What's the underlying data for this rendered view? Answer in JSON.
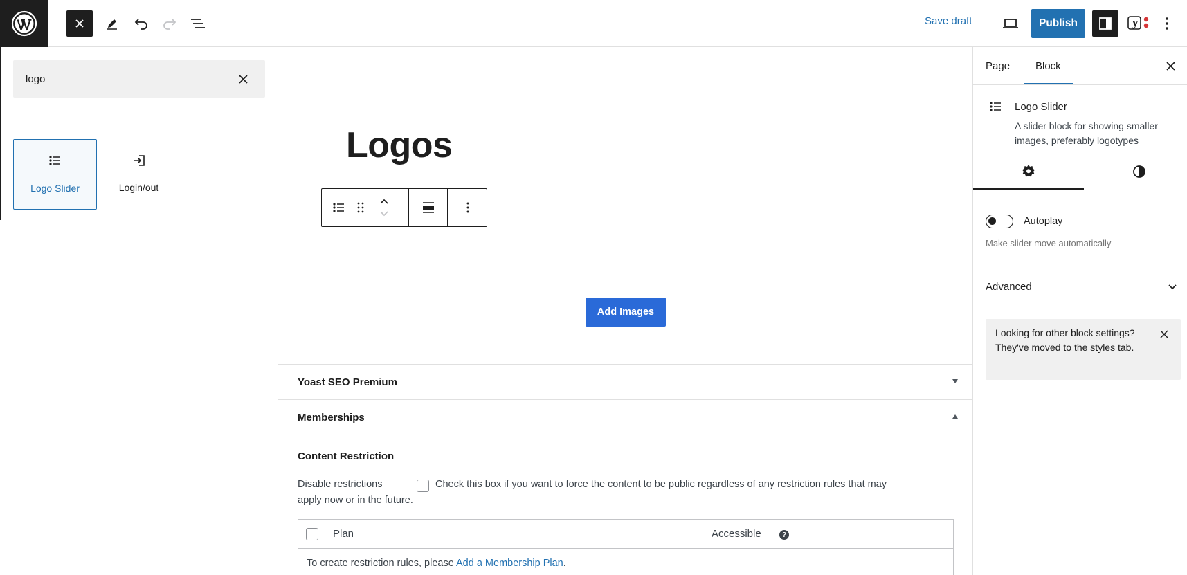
{
  "topbar": {
    "save_draft": "Save draft",
    "publish": "Publish",
    "yoast_letter": "y"
  },
  "inserter": {
    "search_value": "logo",
    "results": [
      {
        "label": "Logo Slider",
        "icon": "list-icon"
      },
      {
        "label": "Login/out",
        "icon": "login-icon"
      }
    ]
  },
  "canvas": {
    "heading": "Logos",
    "add_images": "Add Images"
  },
  "metaboxes": {
    "yoast_title": "Yoast SEO Premium",
    "memberships_title": "Memberships",
    "content_restriction": "Content Restriction",
    "disable_label": "Disable restrictions",
    "disable_desc_1": "Check this box if you want to force the content to be public regardless of any restriction rules that may",
    "disable_desc_2": "apply now or in the future.",
    "col_plan": "Plan",
    "col_accessible": "Accessible",
    "help_glyph": "?",
    "create_rules_text": "To create restriction rules, please",
    "create_rules_link": "Add a Membership Plan",
    "create_rules_end": "."
  },
  "sidebar": {
    "tabs": [
      "Page",
      "Block"
    ],
    "active_tab": "Block",
    "block_title": "Logo Slider",
    "block_desc": "A slider block for showing smaller images, preferably logotypes",
    "autoplay_label": "Autoplay",
    "autoplay_help": "Make slider move automatically",
    "autoplay_on": false,
    "advanced_label": "Advanced",
    "notice_text": "Looking for other block settings? They've moved to the styles tab."
  },
  "colors": {
    "accent": "#2271b1",
    "dark": "#1e1e1e",
    "button_blue": "#2a6ad8"
  }
}
